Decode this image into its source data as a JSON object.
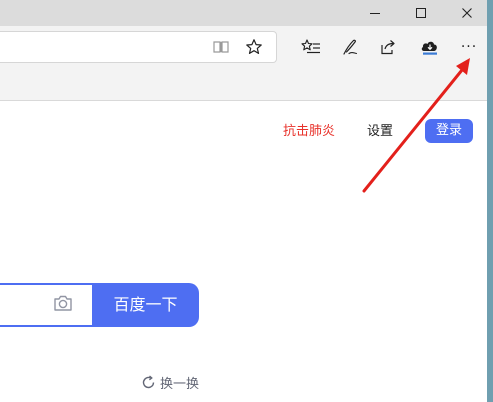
{
  "window": {
    "buttons": [
      "minimize",
      "maximize",
      "close"
    ]
  },
  "toolbar": {
    "icons": [
      "reading-view-icon",
      "favorite-star-icon",
      "favorites-list-icon",
      "pen-icon",
      "share-icon",
      "download-icon",
      "more-icon"
    ],
    "more_label": "···"
  },
  "page": {
    "nav": {
      "anti_epidemic": "抗击肺炎",
      "settings": "设置",
      "login": "登录"
    },
    "search": {
      "button": "百度一下",
      "refresh": "换一换"
    }
  },
  "colors": {
    "accent": "#4e6ef2",
    "red_link": "#e8312a",
    "annotation_arrow": "#e3201b"
  }
}
